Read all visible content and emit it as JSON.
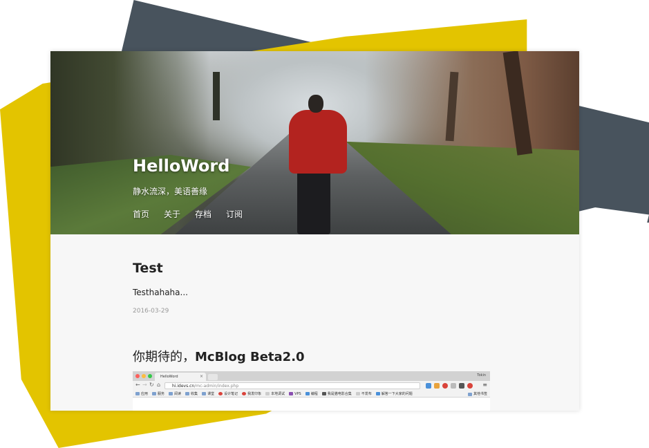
{
  "site": {
    "title": "HelloWord",
    "description": "静水流深，美语善缘",
    "nav": [
      "首页",
      "关于",
      "存档",
      "订阅"
    ]
  },
  "posts": [
    {
      "title": "Test",
      "excerpt": "Testhahaha...",
      "date": "2016-03-29"
    },
    {
      "title_prefix": "你期待的，",
      "title_bold": "McBlog Beta2.0"
    }
  ],
  "browser_screenshot": {
    "tab_title": "HelloWord",
    "tab_close": "×",
    "user": "Tokin",
    "url_host": "hi.idevs.cn",
    "url_path": "/mc-admin/index.php",
    "bookmarks": [
      "应用",
      "服务",
      "阅读",
      "收集",
      "课堂",
      "设计笔记",
      "我发印象",
      "本地调试",
      "VPS",
      "编程",
      "我是猫电影合集",
      "不发布",
      "解答一下大家的问题"
    ],
    "bookmarks_other": "其他书签"
  },
  "colors": {
    "deco_gray": "#48535d",
    "deco_yellow": "#e3c400",
    "accent_red": "#b3231f"
  }
}
